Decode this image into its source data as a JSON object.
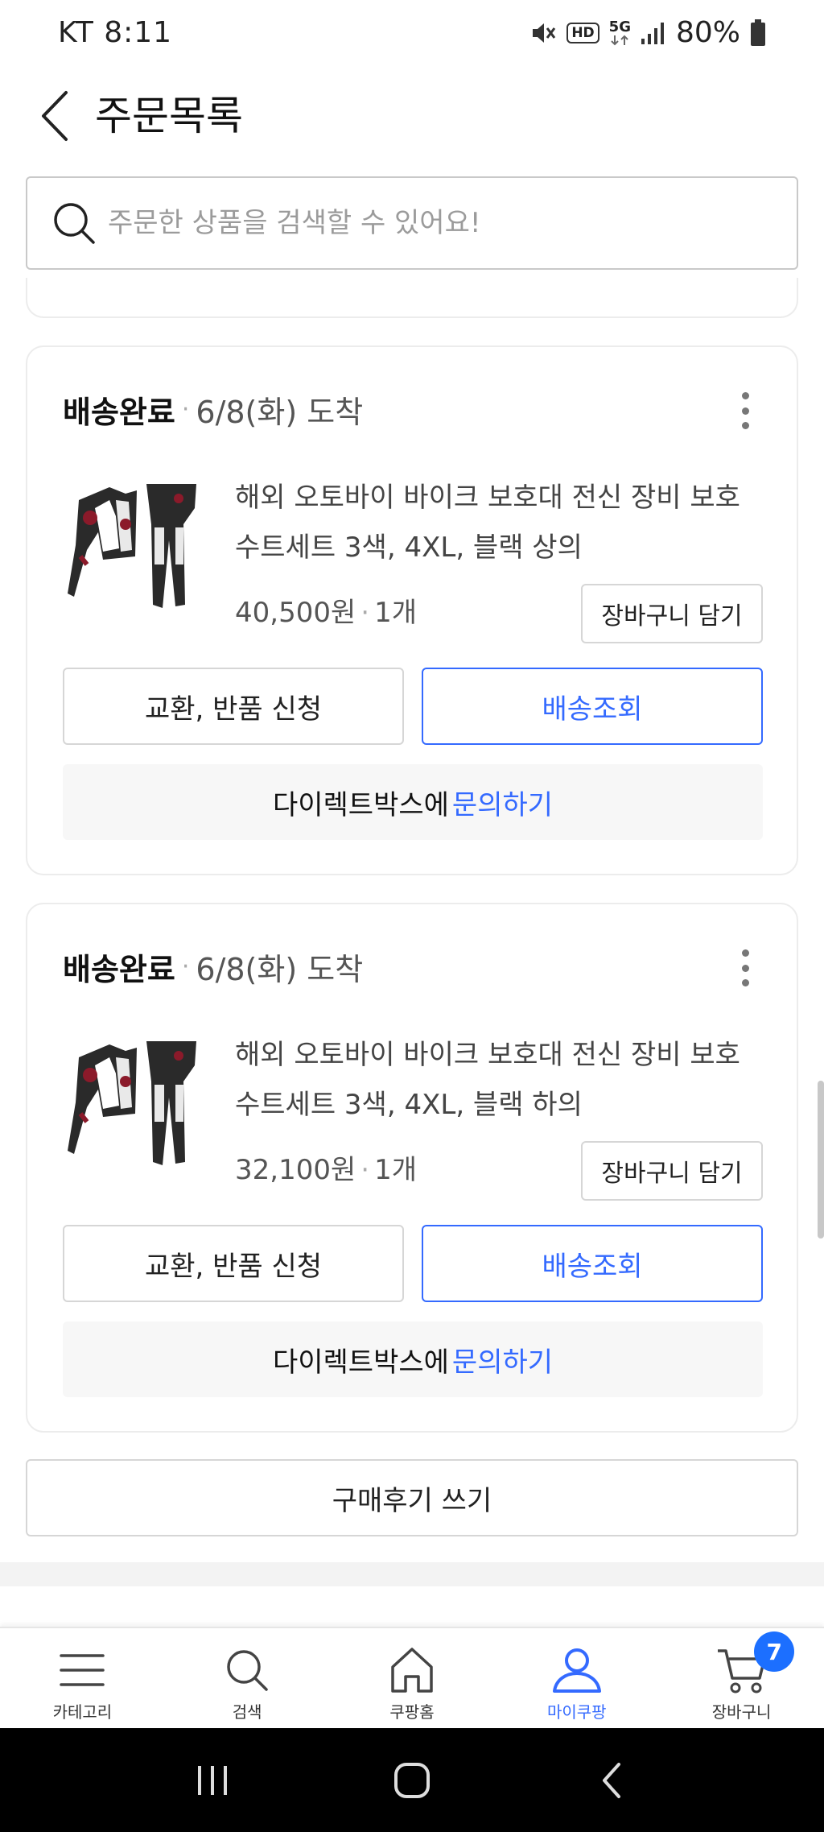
{
  "status_bar": {
    "carrier_time": "KT 8:11",
    "hd": "HD",
    "network": "5G",
    "battery": "80%"
  },
  "header": {
    "title": "주문목록"
  },
  "search": {
    "placeholder": "주문한 상품을 검색할 수 있어요!"
  },
  "orders": [
    {
      "status": "배송완료",
      "arrival": "6/8(화) 도착",
      "product_name": "해외 오토바이 바이크 보호대 전신 장비 보호수트세트 3색, 4XL, 블랙 상의",
      "price": "40,500원",
      "quantity": "1개",
      "cart_label": "장바구니 담기",
      "exchange_label": "교환, 반품 신청",
      "track_label": "배송조회",
      "inquiry_prefix": "다이렉트박스에",
      "inquiry_link": "문의하기"
    },
    {
      "status": "배송완료",
      "arrival": "6/8(화) 도착",
      "product_name": "해외 오토바이 바이크 보호대 전신 장비 보호수트세트 3색, 4XL, 블랙 하의",
      "price": "32,100원",
      "quantity": "1개",
      "cart_label": "장바구니 담기",
      "exchange_label": "교환, 반품 신청",
      "track_label": "배송조회",
      "inquiry_prefix": "다이렉트박스에",
      "inquiry_link": "문의하기"
    }
  ],
  "review_label": "구매후기 쓰기",
  "bottom_nav": {
    "items": [
      {
        "label": "카테고리",
        "icon": "menu-icon"
      },
      {
        "label": "검색",
        "icon": "search-icon"
      },
      {
        "label": "쿠팡홈",
        "icon": "home-icon"
      },
      {
        "label": "마이쿠팡",
        "icon": "person-icon",
        "active": true
      },
      {
        "label": "장바구니",
        "icon": "cart-icon",
        "badge": "7"
      }
    ]
  },
  "colors": {
    "accent": "#346aff",
    "badge": "#1c6fff"
  }
}
